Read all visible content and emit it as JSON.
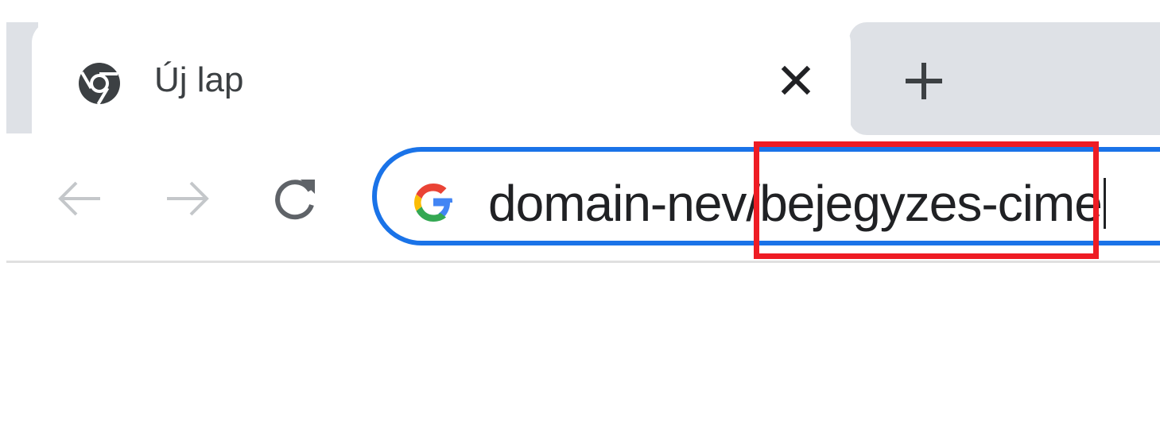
{
  "tab": {
    "title": "Új lap",
    "favicon": "chrome-icon",
    "close_icon": "close-icon"
  },
  "tabstrip": {
    "new_tab_icon": "plus-icon"
  },
  "toolbar": {
    "back_icon": "arrow-left-icon",
    "forward_icon": "arrow-right-icon",
    "reload_icon": "reload-icon"
  },
  "omnibox": {
    "search_engine_icon": "google-g-icon",
    "url_prefix": "domain-nev/",
    "url_highlighted": "bejegyzes-cime"
  },
  "colors": {
    "accent": "#1a73e8",
    "highlight_box": "#ee1c24",
    "tabstrip_bg": "#dee1e6"
  }
}
